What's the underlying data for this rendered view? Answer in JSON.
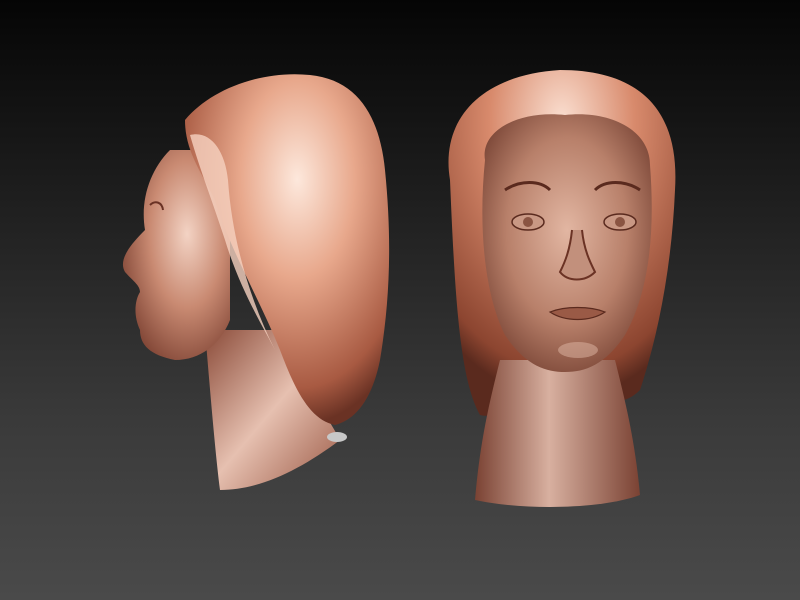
{
  "scene": {
    "subject": "",
    "colors": {
      "background_top": "#050505",
      "background_bottom": "#4a4a4a",
      "clay_dark": "#7a3f30",
      "clay_mid": "#b8705a",
      "clay_light": "#f0c0a8",
      "clay_highlight": "#fde8dc"
    },
    "views": [
      {
        "name": "side-profile-view"
      },
      {
        "name": "front-view"
      }
    ]
  }
}
